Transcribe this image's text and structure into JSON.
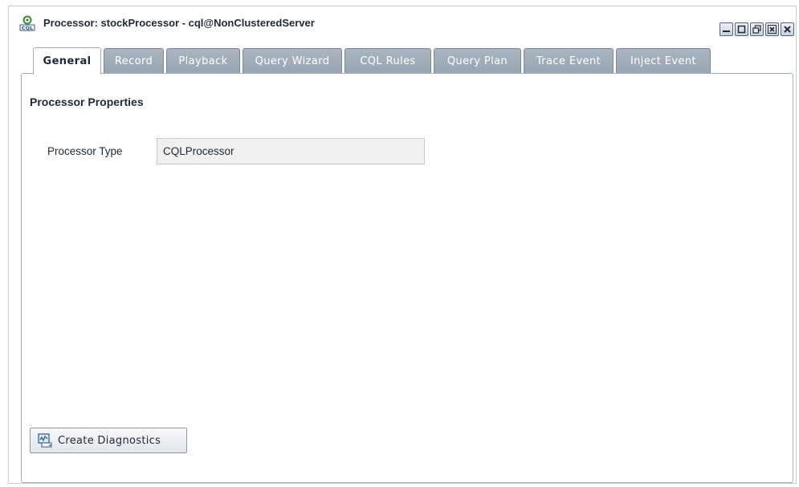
{
  "window": {
    "title": "Processor: stockProcessor - cql@NonClusteredServer",
    "app_icon": "cql-processor-icon",
    "controls": [
      {
        "name": "minimize-button",
        "icon": "minimize-icon"
      },
      {
        "name": "maximize-button",
        "icon": "maximize-icon"
      },
      {
        "name": "restore-button",
        "icon": "restore-icon"
      },
      {
        "name": "close-other-button",
        "icon": "close-other-icon"
      },
      {
        "name": "close-button",
        "icon": "close-icon"
      }
    ]
  },
  "tabs": [
    {
      "label": "General",
      "active": true
    },
    {
      "label": "Record"
    },
    {
      "label": "Playback"
    },
    {
      "label": "Query Wizard"
    },
    {
      "label": "CQL Rules"
    },
    {
      "label": "Query Plan"
    },
    {
      "label": "Trace Event"
    },
    {
      "label": "Inject Event"
    }
  ],
  "general": {
    "section_title": "Processor Properties",
    "processor_type_label": "Processor Type",
    "processor_type_value": "CQLProcessor",
    "create_diagnostics_label": "Create Diagnostics"
  },
  "colors": {
    "tab_inactive": "#9eaab7",
    "tab_active": "#ffffff",
    "border": "#a3b0bf",
    "text": "#1e2a36"
  }
}
